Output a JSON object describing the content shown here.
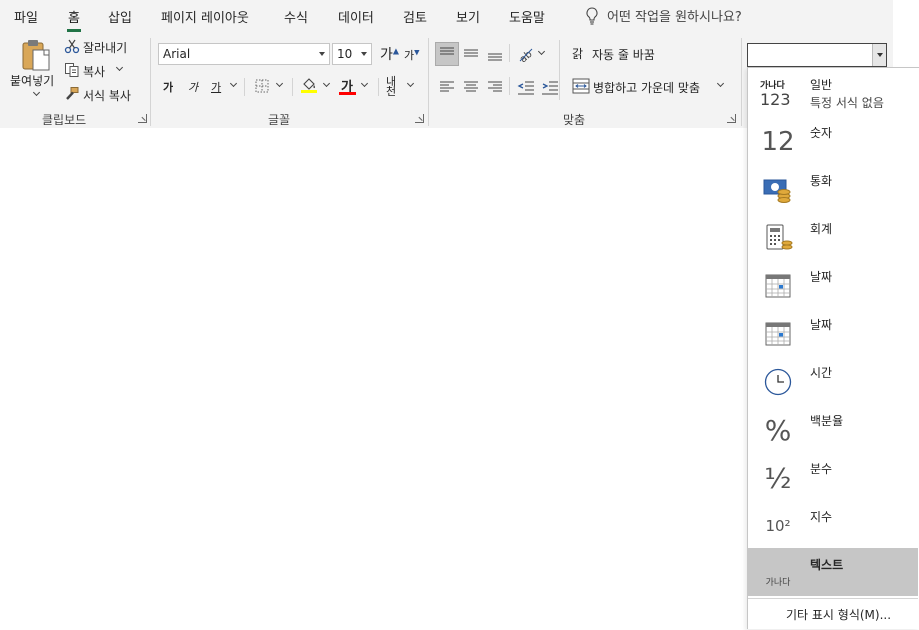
{
  "tabs": [
    "파일",
    "홈",
    "삽입",
    "페이지 레이아웃",
    "수식",
    "데이터",
    "검토",
    "보기",
    "도움말"
  ],
  "active_tab": "홈",
  "tell_me": "어떤 작업을 원하시나요?",
  "clipboard": {
    "paste": "붙여넣기",
    "cut": "잘라내기",
    "copy": "복사",
    "format_painter": "서식 복사",
    "group": "클립보드"
  },
  "font": {
    "name": "Arial",
    "size": "10",
    "grow": "가",
    "shrink": "가",
    "bold": "가",
    "italic": "가",
    "underline": "가",
    "font_color": "가",
    "phonetic": "내천",
    "group": "글꼴",
    "highlight_color": "#ffff00",
    "font_color_bar": "#ff0000"
  },
  "alignment": {
    "wrap_text": "자동 줄 바꿈",
    "merge_center": "병합하고 가운데 맞춤",
    "orient_glyph": "갉",
    "group": "맞춤"
  },
  "number_format": {
    "current_value": "",
    "items": [
      {
        "glyph_top": "가나다",
        "glyph": "123",
        "label": "일반",
        "sub": "특정 서식 없음"
      },
      {
        "glyph": "12",
        "label": "숫자"
      },
      {
        "glyph": "",
        "label": "통화"
      },
      {
        "glyph": "",
        "label": "회계"
      },
      {
        "glyph": "",
        "label": "날짜"
      },
      {
        "glyph": "",
        "label": "날짜"
      },
      {
        "glyph": "",
        "label": "시간"
      },
      {
        "glyph": "%",
        "label": "백분율"
      },
      {
        "glyph": "½",
        "label": "분수"
      },
      {
        "glyph": "10²",
        "label": "지수"
      },
      {
        "glyph": "가나다",
        "label": "텍스트"
      }
    ],
    "selected_index": 10,
    "more": "기타 표시 형식(M)..."
  },
  "colors": {
    "accent": "#217346",
    "ribbon_bg": "#f3f3f3",
    "selected_item": "#c6c6c6"
  }
}
